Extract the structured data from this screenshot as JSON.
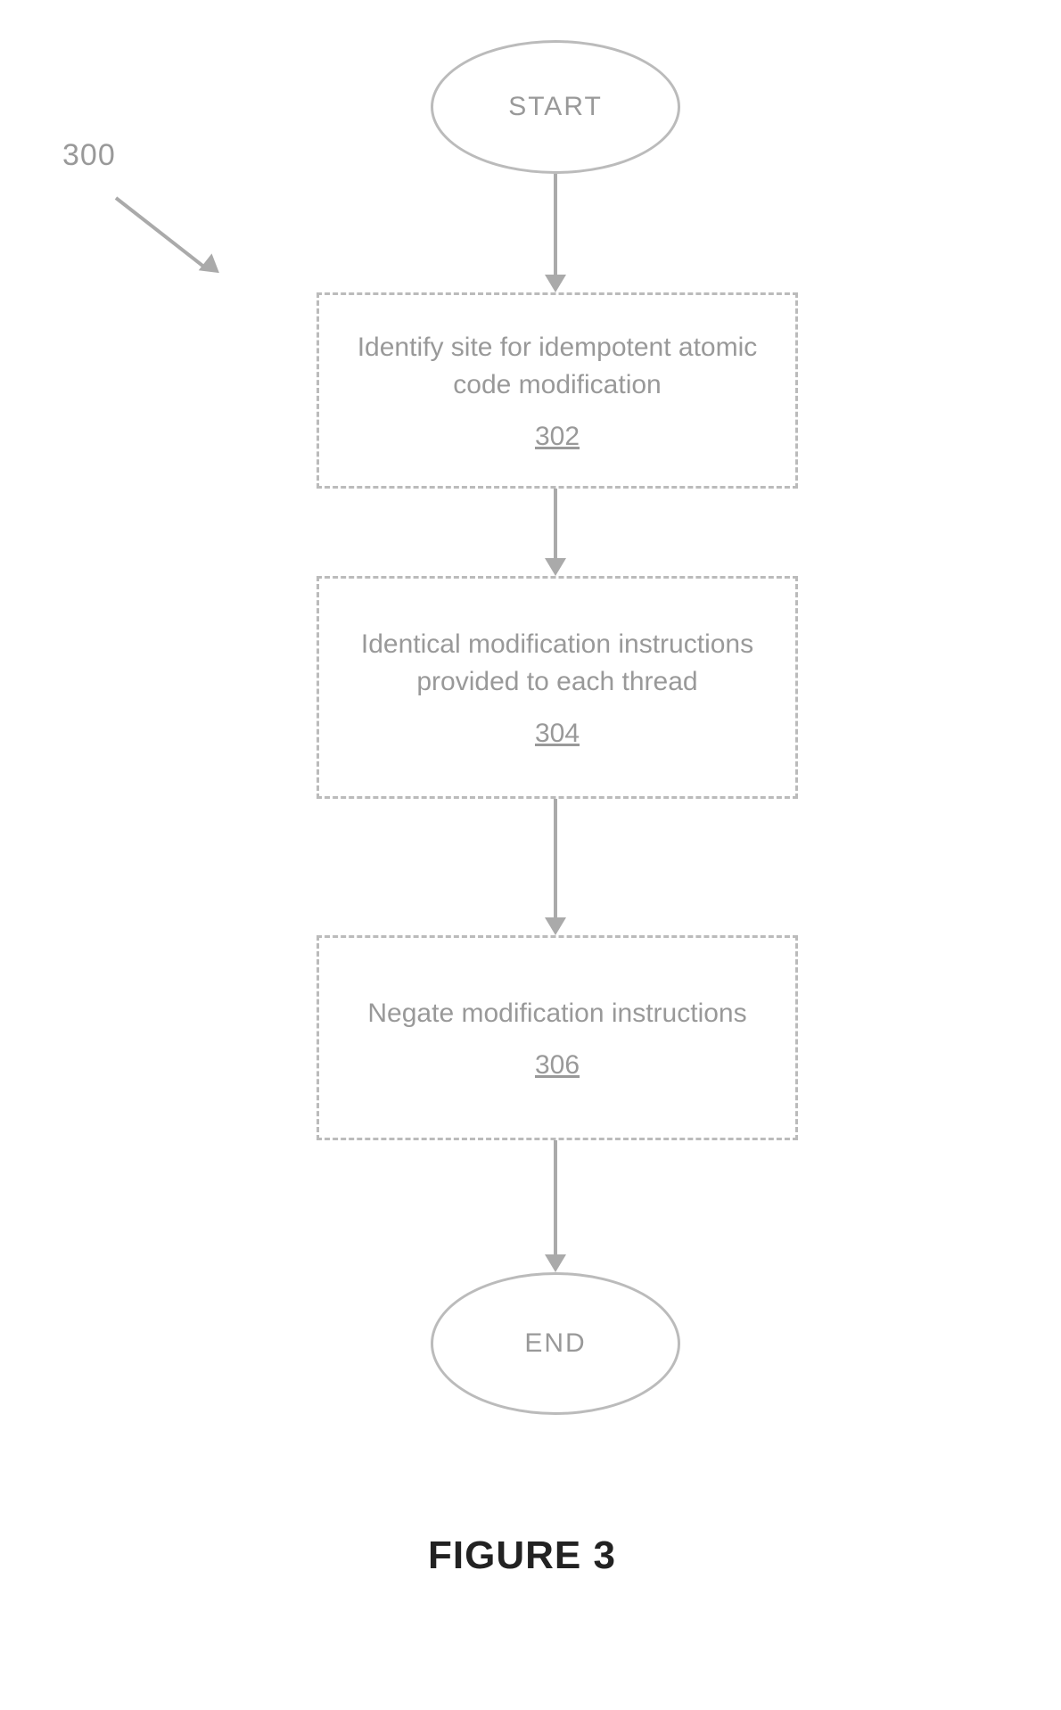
{
  "chart_data": {
    "type": "flowchart",
    "title": "FIGURE 3",
    "reference_number": "300",
    "nodes": [
      {
        "id": "start",
        "shape": "ellipse",
        "label": "START"
      },
      {
        "id": "302",
        "shape": "rect",
        "label": "Identify site for idempotent atomic code modification",
        "ref": "302"
      },
      {
        "id": "304",
        "shape": "rect",
        "label": "Identical modification instructions provided to each thread",
        "ref": "304"
      },
      {
        "id": "306",
        "shape": "rect",
        "label": "Negate modification instructions",
        "ref": "306"
      },
      {
        "id": "end",
        "shape": "ellipse",
        "label": "END"
      }
    ],
    "edges": [
      {
        "from": "start",
        "to": "302"
      },
      {
        "from": "302",
        "to": "304"
      },
      {
        "from": "304",
        "to": "306"
      },
      {
        "from": "306",
        "to": "end"
      }
    ]
  },
  "pointer": {
    "label": "300"
  },
  "start": {
    "label": "START"
  },
  "end": {
    "label": "END"
  },
  "step302": {
    "label": "Identify site for idempotent atomic code modification",
    "ref": "302"
  },
  "step304": {
    "label": "Identical modification instructions provided to each thread",
    "ref": "304"
  },
  "step306": {
    "label": "Negate modification instructions",
    "ref": "306"
  },
  "caption": "FIGURE 3"
}
